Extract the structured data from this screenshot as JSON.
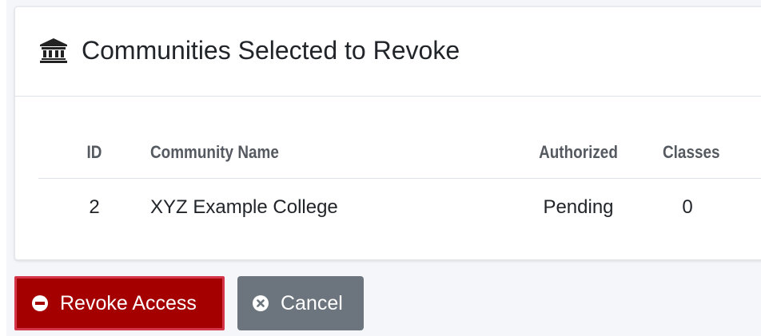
{
  "card": {
    "title": "Communities Selected to Revoke",
    "icon": "institution-icon"
  },
  "table": {
    "columns": [
      "ID",
      "Community Name",
      "Authorized",
      "Classes"
    ],
    "rows": [
      {
        "id": "2",
        "name": "XYZ Example College",
        "authorized": "Pending",
        "classes": "0"
      }
    ]
  },
  "actions": {
    "revoke_label": "Revoke Access",
    "revoke_icon": "minus-circle-icon",
    "cancel_label": "Cancel",
    "cancel_icon": "times-circle-icon"
  },
  "colors": {
    "revoke_bg": "#a50000",
    "cancel_bg": "#6c757d",
    "header_text": "#555a60"
  }
}
